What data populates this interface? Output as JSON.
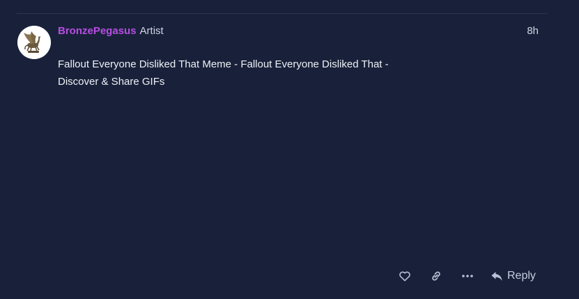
{
  "post": {
    "author": {
      "username": "BronzePegasus",
      "title": "Artist",
      "avatar_icon": "bronze-pegasus-statue"
    },
    "date": "8h",
    "body": {
      "line1": "Fallout Everyone Disliked That Meme - Fallout Everyone Disliked That -",
      "line2": "Discover & Share GIFs"
    }
  },
  "actions": {
    "like_icon": "heart-icon",
    "link_icon": "link-icon",
    "more_icon": "ellipsis-icon",
    "reply_icon": "reply-arrow-icon",
    "reply_label": "Reply"
  },
  "colors": {
    "background": "#19213a",
    "username": "#b74ee3",
    "text": "#eef1f7",
    "muted": "#b9c1d6"
  }
}
